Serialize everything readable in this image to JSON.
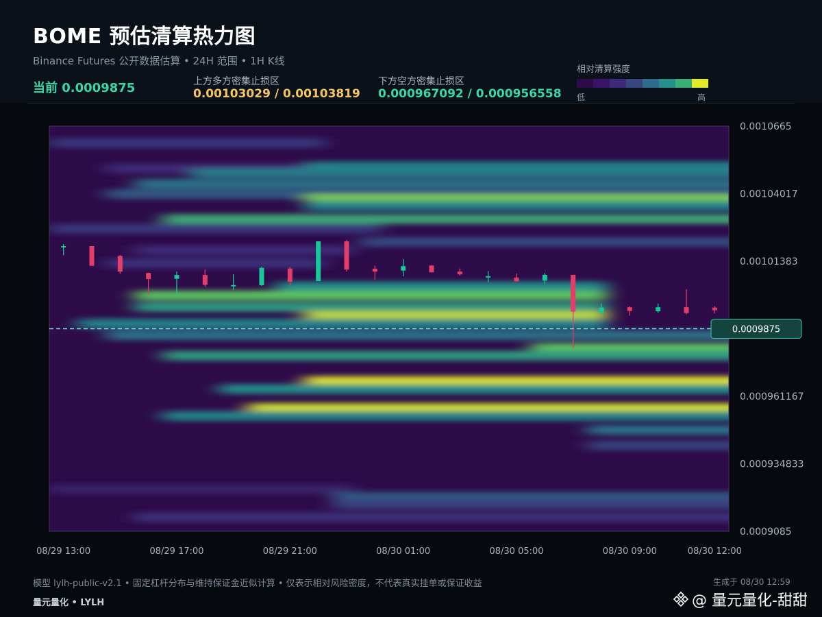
{
  "header": {
    "title": "BOME 预估清算热力图",
    "subtitle": "Binance Futures 公开数据估算  •  24H 范围  •  1H K线",
    "current": "当前 0.0009875",
    "upper_zone_label": "上方多方密集止损区",
    "upper_zone_value": "0.00103029 / 0.00103819",
    "lower_zone_label": "下方空方密集止损区",
    "lower_zone_value": "0.000967092 / 0.000956558"
  },
  "legend": {
    "title": "相对清算强度",
    "low": "低",
    "high": "高",
    "colors": [
      "#2e0b49",
      "#3a1466",
      "#3e2a7a",
      "#37467f",
      "#2f6b8a",
      "#26908b",
      "#39b07a",
      "#e3ea2a"
    ]
  },
  "colors": {
    "accent": "#39d7a8",
    "upper_zone": "#f5c466",
    "up_candle": "#18c79a",
    "down_candle": "#e23e6a",
    "current_line": "#7fe0d8",
    "price_tag_bg": "#15433e"
  },
  "chart_data": {
    "type": "heatmap",
    "title": "BOME 预估清算热力图",
    "y_ticks": [
      "0.0010665",
      "0.00104017",
      "0.00101383",
      "0.000987501",
      "0.000961167",
      "0.000934833",
      "0.0009085"
    ],
    "y_tick_values": [
      0.0010665,
      0.00104017,
      0.00101383,
      0.000987501,
      0.000961167,
      0.000934833,
      0.0009085
    ],
    "ylim": [
      0.0009085,
      0.0010665
    ],
    "x_ticks": [
      "08/29 13:00",
      "08/29 17:00",
      "08/29 21:00",
      "08/30 01:00",
      "08/30 05:00",
      "08/30 09:00",
      "08/30 12:00"
    ],
    "x_tick_hours": [
      0,
      4,
      8,
      12,
      16,
      20,
      23
    ],
    "x_range_hours": [
      -0.5,
      23.5
    ],
    "current_price": 0.0009875,
    "current_price_label": "0.0009875",
    "candles": [
      {
        "t": 0,
        "o": 1.01933,
        "h": 1.02052,
        "l": 1.01614,
        "c": 1.01972
      },
      {
        "t": 1,
        "o": 1.01972,
        "h": 1.01972,
        "l": 1.01322,
        "c": 1.01203
      },
      {
        "t": 2,
        "o": 1.01587,
        "h": 1.01627,
        "l": 1.00898,
        "c": 1.00977
      },
      {
        "t": 3,
        "o": 1.00925,
        "h": 1.00938,
        "l": 1.00089,
        "c": 1.00686
      },
      {
        "t": 4,
        "o": 1.00699,
        "h": 1.00978,
        "l": 1.00062,
        "c": 1.00845
      },
      {
        "t": 5,
        "o": 1.00845,
        "h": 1.0107,
        "l": 1.00378,
        "c": 1.00461
      },
      {
        "t": 6,
        "o": 1.00421,
        "h": 1.00872,
        "l": 1.00262,
        "c": 1.00454
      },
      {
        "t": 7,
        "o": 1.00448,
        "h": 1.01163,
        "l": 1.00421,
        "c": 1.01124
      },
      {
        "t": 8,
        "o": 1.01097,
        "h": 1.01163,
        "l": 1.00421,
        "c": 1.0058
      },
      {
        "t": 9,
        "o": 1.00607,
        "h": 1.02158,
        "l": 1.00607,
        "c": 1.02158
      },
      {
        "t": 10,
        "o": 1.02158,
        "h": 1.02211,
        "l": 1.00978,
        "c": 1.01057
      },
      {
        "t": 11,
        "o": 1.01087,
        "h": 1.01216,
        "l": 1.0066,
        "c": 1.00977
      },
      {
        "t": 12,
        "o": 1.01017,
        "h": 1.01466,
        "l": 1.00791,
        "c": 1.0119
      },
      {
        "t": 13,
        "o": 1.01216,
        "h": 1.01229,
        "l": 1.0095,
        "c": 1.0095
      },
      {
        "t": 14,
        "o": 1.00977,
        "h": 1.01097,
        "l": 1.00822,
        "c": 1.00871
      },
      {
        "t": 15,
        "o": 1.00799,
        "h": 1.00997,
        "l": 1.0056,
        "c": 1.00799
      },
      {
        "t": 16,
        "o": 1.00745,
        "h": 1.00897,
        "l": 1.00586,
        "c": 1.00599
      },
      {
        "t": 17,
        "o": 1.00625,
        "h": 1.00924,
        "l": 1.00486,
        "c": 1.00851
      },
      {
        "t": 18,
        "o": 1.00851,
        "h": 1.00851,
        "l": 0.97986,
        "c": 0.99416
      },
      {
        "t": 19,
        "o": 0.99376,
        "h": 0.99734,
        "l": 0.9931,
        "c": 0.99575
      },
      {
        "t": 20,
        "o": 0.99588,
        "h": 0.99628,
        "l": 0.99257,
        "c": 0.99443
      },
      {
        "t": 21,
        "o": 0.9943,
        "h": 0.99734,
        "l": 0.99376,
        "c": 0.99588
      },
      {
        "t": 22,
        "o": 0.99588,
        "h": 1.00287,
        "l": 0.9931,
        "c": 0.99363
      },
      {
        "t": 23,
        "o": 0.99575,
        "h": 0.99628,
        "l": 0.9935,
        "c": 0.99469
      }
    ],
    "candles_scale_note": "",
    "heat_bands": [
      {
        "price": 1.06,
        "t_from": 0,
        "t_to": 8,
        "intensity": 0.25
      },
      {
        "price": 1.05,
        "t_from": 2,
        "t_to": 8,
        "intensity": 0.2
      },
      {
        "price": 1.0508,
        "t_from": 9,
        "t_to": 23,
        "intensity": 0.55
      },
      {
        "price": 1.0482,
        "t_from": 5,
        "t_to": 23,
        "intensity": 0.5
      },
      {
        "price": 1.044,
        "t_from": 3,
        "t_to": 23,
        "intensity": 0.45
      },
      {
        "price": 1.04,
        "t_from": 2,
        "t_to": 23,
        "intensity": 0.35
      },
      {
        "price": 1.03819,
        "t_from": 9,
        "t_to": 23,
        "intensity": 0.85
      },
      {
        "price": 1.0354,
        "t_from": 9,
        "t_to": 23,
        "intensity": 0.55
      },
      {
        "price": 1.03029,
        "t_from": 4,
        "t_to": 23,
        "intensity": 0.7
      },
      {
        "price": 1.0265,
        "t_from": 0,
        "t_to": 10,
        "intensity": 0.25
      },
      {
        "price": 1.0213,
        "t_from": 11,
        "t_to": 23,
        "intensity": 0.3
      },
      {
        "price": 1.0181,
        "t_from": 3,
        "t_to": 9,
        "intensity": 0.2
      },
      {
        "price": 1.013,
        "t_from": 2,
        "t_to": 8,
        "intensity": 0.22
      },
      {
        "price": 1.004,
        "t_from": 8,
        "t_to": 18,
        "intensity": 0.6
      },
      {
        "price": 1.0005,
        "t_from": 3,
        "t_to": 18,
        "intensity": 0.8
      },
      {
        "price": 0.996,
        "t_from": 3,
        "t_to": 18,
        "intensity": 0.65
      },
      {
        "price": 0.9925,
        "t_from": 9,
        "t_to": 18,
        "intensity": 0.95
      },
      {
        "price": 0.9895,
        "t_from": 1,
        "t_to": 18,
        "intensity": 0.55
      },
      {
        "price": 0.985,
        "t_from": 2,
        "t_to": 23,
        "intensity": 0.45
      },
      {
        "price": 0.98,
        "t_from": 17,
        "t_to": 23,
        "intensity": 0.8
      },
      {
        "price": 0.977,
        "t_from": 4,
        "t_to": 23,
        "intensity": 0.65
      },
      {
        "price": 0.96709,
        "t_from": 9,
        "t_to": 23,
        "intensity": 1.0
      },
      {
        "price": 0.964,
        "t_from": 6,
        "t_to": 23,
        "intensity": 0.6
      },
      {
        "price": 0.95656,
        "t_from": 7,
        "t_to": 23,
        "intensity": 0.98
      },
      {
        "price": 0.9535,
        "t_from": 4,
        "t_to": 23,
        "intensity": 0.55
      },
      {
        "price": 0.948,
        "t_from": 19,
        "t_to": 23,
        "intensity": 0.45
      },
      {
        "price": 0.942,
        "t_from": 19,
        "t_to": 23,
        "intensity": 0.28
      },
      {
        "price": 0.925,
        "t_from": 0,
        "t_to": 9,
        "intensity": 0.15
      },
      {
        "price": 0.922,
        "t_from": 10,
        "t_to": 23,
        "intensity": 0.35
      },
      {
        "price": 0.919,
        "t_from": 10,
        "t_to": 23,
        "intensity": 0.28
      },
      {
        "price": 0.914,
        "t_from": 3,
        "t_to": 23,
        "intensity": 0.22
      }
    ]
  },
  "footer": {
    "note": "模型 lylh-public-v2.1  •  固定杠杆分布与维持保证金近似计算  •  仅表示相对风险密度，不代表真实挂单或保证收益",
    "brand": "量元量化  •  LYLH",
    "generated": "生成于 08/30 12:59",
    "watermark": "@ 量元量化-甜甜"
  }
}
